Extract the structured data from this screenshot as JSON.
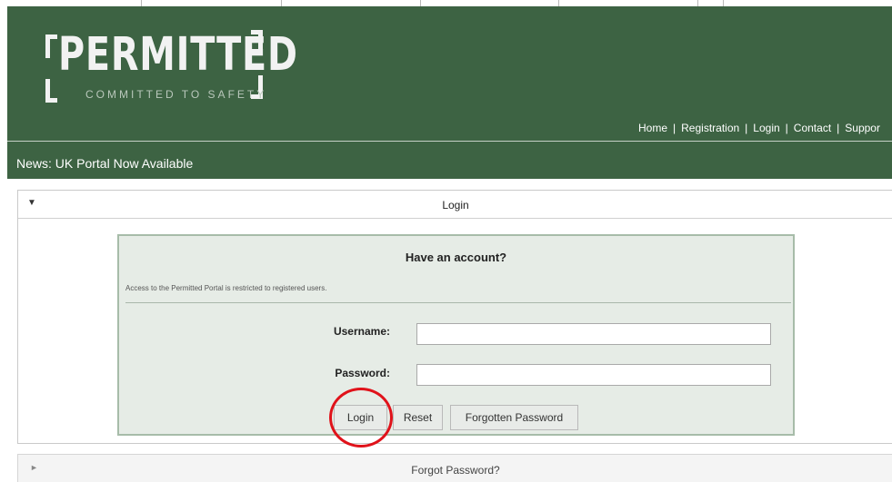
{
  "header": {
    "logo_word": "PERMITTED",
    "logo_tagline": "COMMITTED TO SAFETY",
    "nav": [
      "Home",
      "Registration",
      "Login",
      "Contact",
      "Suppor"
    ],
    "nav_separator": "|",
    "news": "News: UK Portal Now Available",
    "background_color": "#3d6343"
  },
  "login_panel": {
    "title": "Login",
    "box": {
      "heading": "Have an account?",
      "notice": "Access to the Permitted Portal is restricted to registered users.",
      "username_label": "Username:",
      "username_value": "",
      "password_label": "Password:",
      "password_value": "",
      "buttons": {
        "login": "Login",
        "reset": "Reset",
        "forgot": "Forgotten Password"
      }
    }
  },
  "forgot_panel": {
    "title": "Forgot Password?"
  },
  "icons": {
    "expanded_caret": "caret-down-icon",
    "collapsed_caret": "caret-right-icon"
  },
  "annotation": {
    "highlight_color": "#e0121a"
  }
}
